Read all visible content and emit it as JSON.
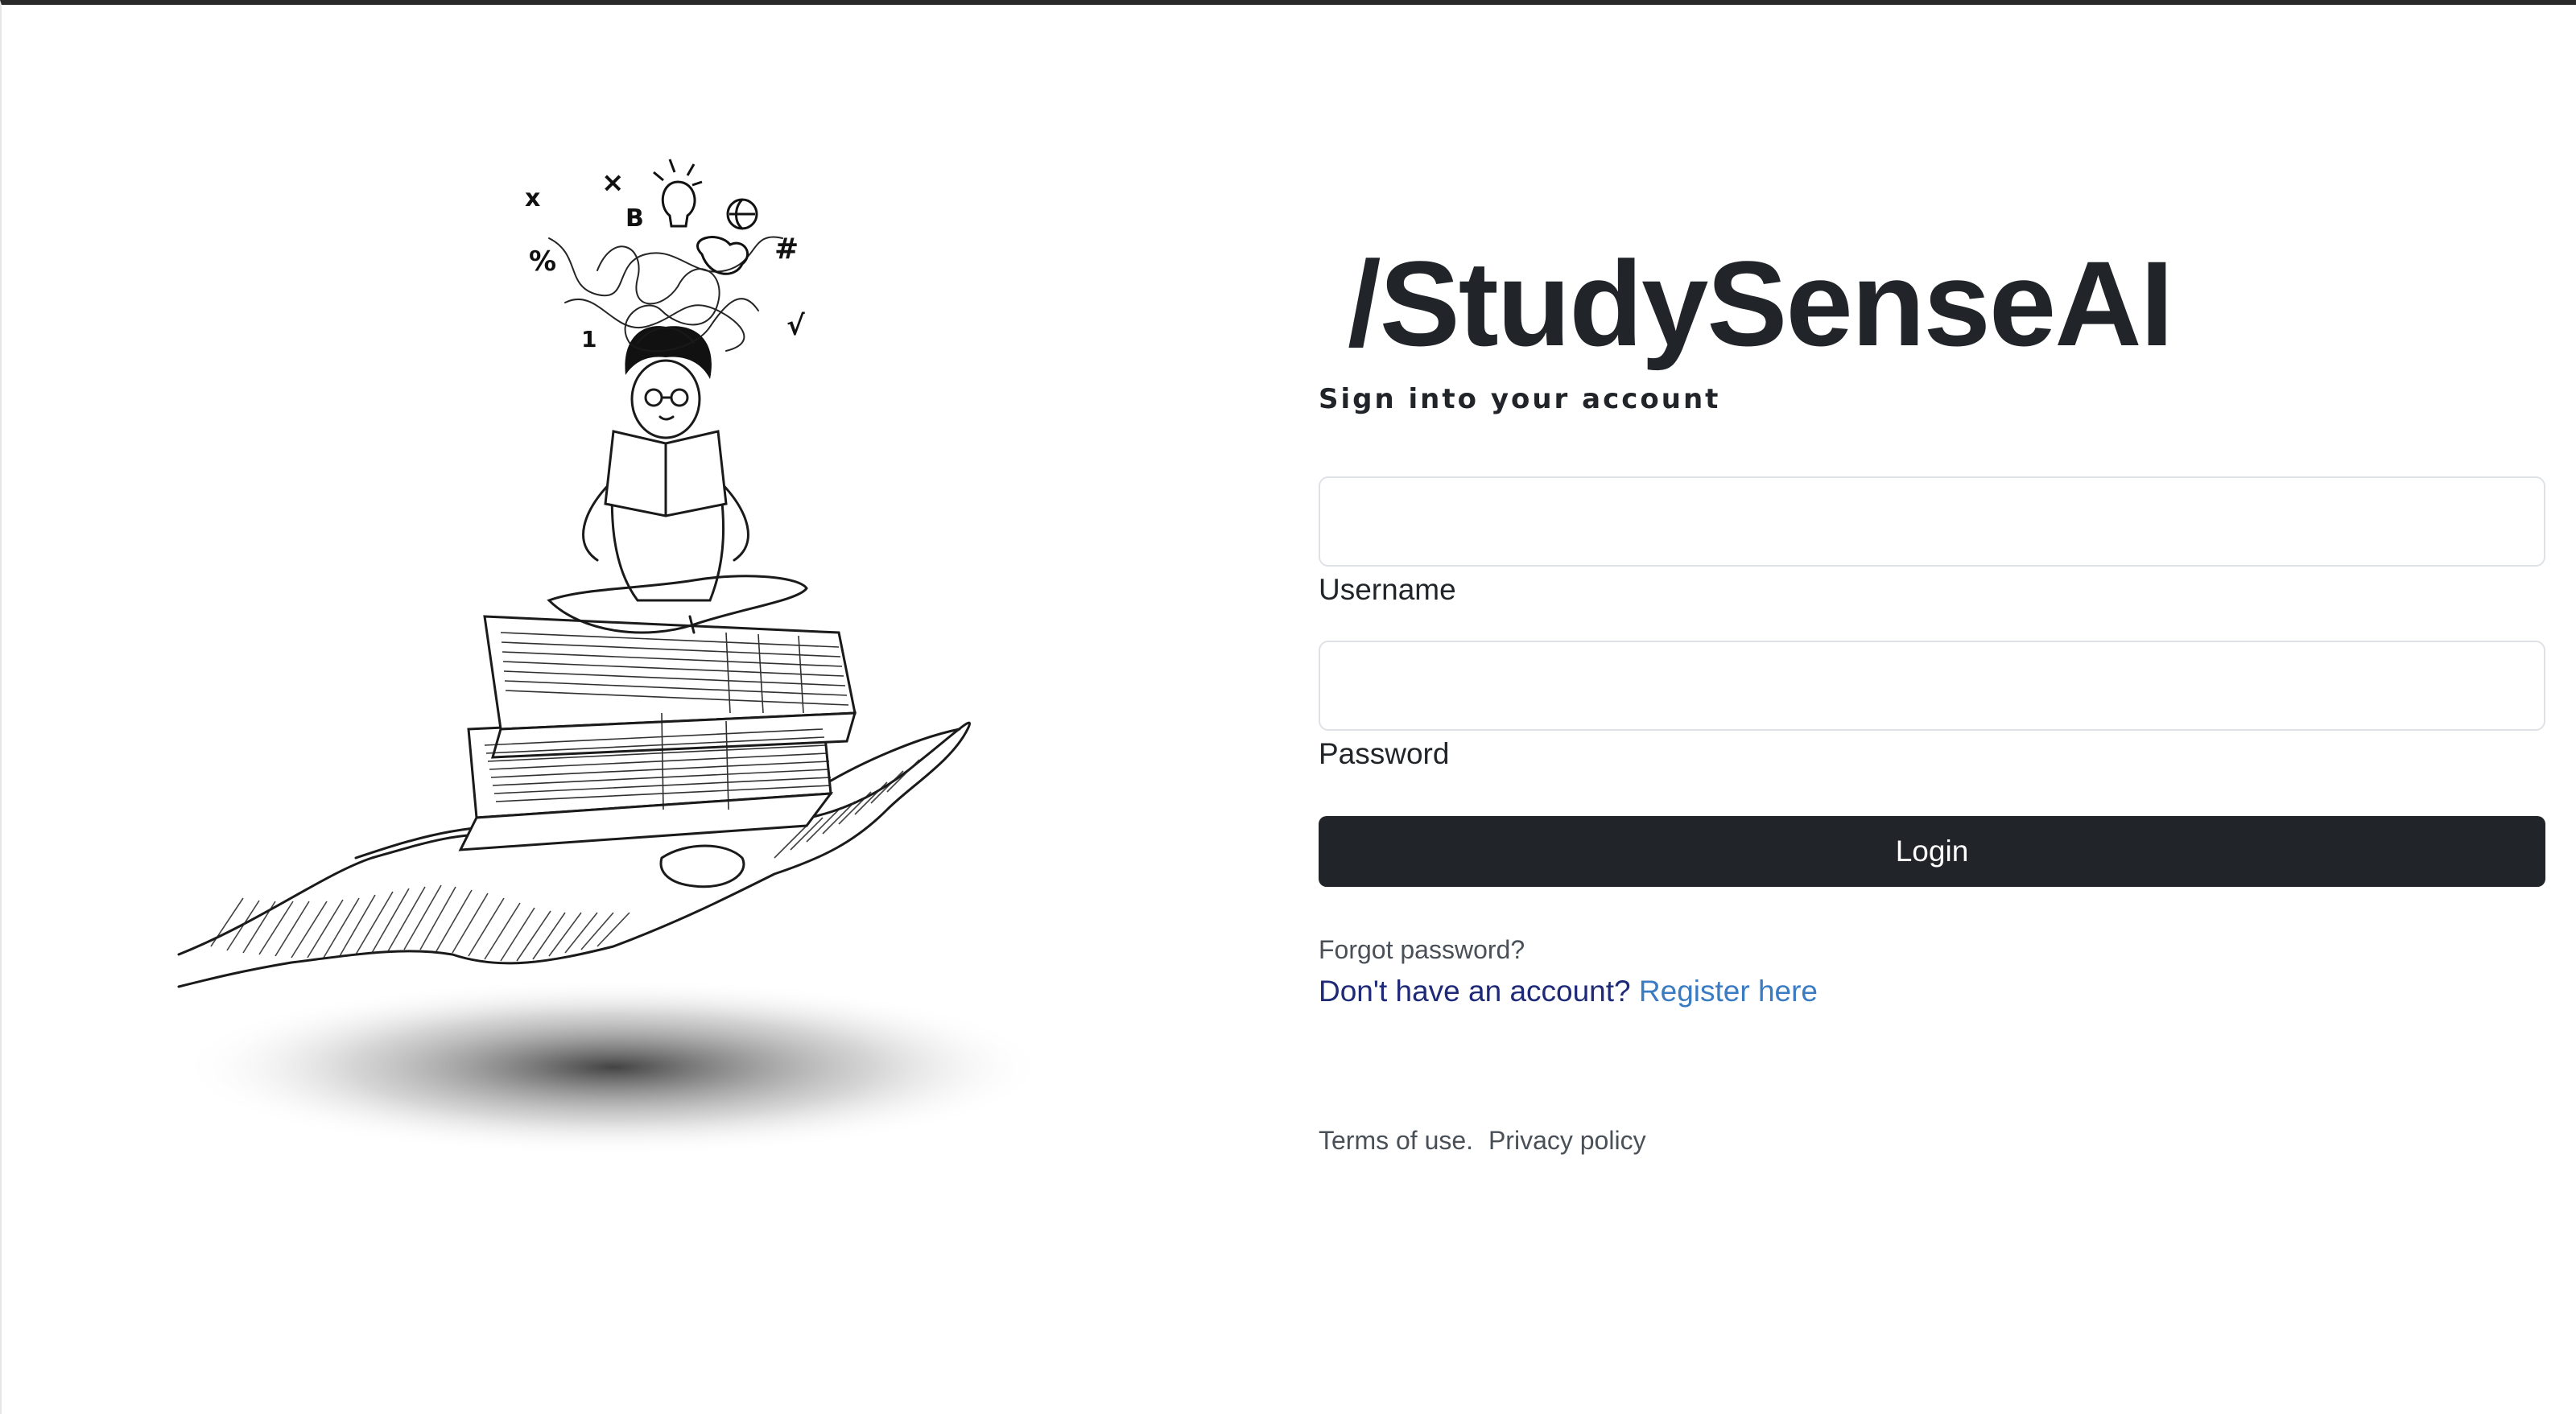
{
  "brand": {
    "logo_text": "/StudySenseAI"
  },
  "login": {
    "subtitle": "Sign into your account",
    "username_label": "Username",
    "username_value": "",
    "password_label": "Password",
    "password_value": "",
    "submit_label": "Login",
    "forgot_password": "Forgot password?",
    "register_prompt": "Don't have an account?",
    "register_link": "Register here"
  },
  "footer": {
    "terms": "Terms of use.",
    "privacy": "Privacy policy"
  },
  "illustration": {
    "icon": "student-reading-on-books-in-hand-sketch"
  },
  "colors": {
    "primary_dark": "#212529",
    "link_blue": "#3b7bc2",
    "prompt_navy": "#1e2a78",
    "input_border": "#dee2e6"
  }
}
